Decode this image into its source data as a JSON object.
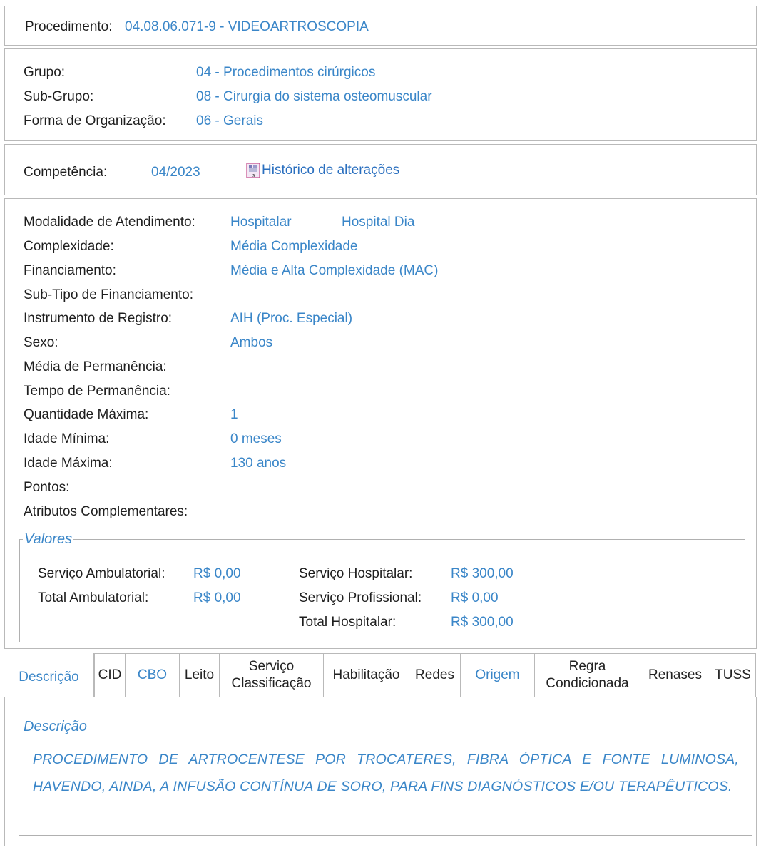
{
  "procedimento": {
    "label": "Procedimento:",
    "value": "04.08.06.071-9 - VIDEOARTROSCOPIA"
  },
  "classificacao": {
    "grupo_label": "Grupo:",
    "grupo_value": "04 - Procedimentos cirúrgicos",
    "subgrupo_label": "Sub-Grupo:",
    "subgrupo_value": "08 - Cirurgia do sistema osteomuscular",
    "forma_label": "Forma de Organização:",
    "forma_value": "06 - Gerais"
  },
  "competencia": {
    "label": "Competência:",
    "value": "04/2023",
    "historico_link": "Histórico de alterações",
    "historico_icon": "excel-icon"
  },
  "atributos": {
    "modalidade_label": "Modalidade de Atendimento:",
    "modalidade_value_1": "Hospitalar",
    "modalidade_value_2": "Hospital Dia",
    "complexidade_label": "Complexidade:",
    "complexidade_value": "Média Complexidade",
    "financiamento_label": "Financiamento:",
    "financiamento_value": "Média e Alta Complexidade (MAC)",
    "subtipo_label": "Sub-Tipo de Financiamento:",
    "instrumento_label": "Instrumento de Registro:",
    "instrumento_value": "AIH (Proc. Especial)",
    "sexo_label": "Sexo:",
    "sexo_value": "Ambos",
    "media_perm_label": "Média de Permanência:",
    "tempo_perm_label": "Tempo de Permanência:",
    "qtd_max_label": "Quantidade Máxima:",
    "qtd_max_value": "1",
    "idade_min_label": "Idade Mínima:",
    "idade_min_value": "0 meses",
    "idade_max_label": "Idade Máxima:",
    "idade_max_value": "130 anos",
    "pontos_label": "Pontos:",
    "atrib_compl_label": "Atributos Complementares:"
  },
  "valores": {
    "legend": "Valores",
    "serv_amb_label": "Serviço Ambulatorial:",
    "serv_amb_value": "R$ 0,00",
    "total_amb_label": "Total Ambulatorial:",
    "total_amb_value": "R$ 0,00",
    "serv_hosp_label": "Serviço Hospitalar:",
    "serv_hosp_value": "R$ 300,00",
    "serv_prof_label": "Serviço Profissional:",
    "serv_prof_value": "R$ 0,00",
    "total_hosp_label": "Total Hospitalar:",
    "total_hosp_value": "R$ 300,00"
  },
  "tabs": {
    "descricao": "Descrição",
    "cid": "CID",
    "cbo": "CBO",
    "leito": "Leito",
    "servico_l1": "Serviço",
    "servico_l2": "Classificação",
    "habilitacao": "Habilitação",
    "redes": "Redes",
    "origem": "Origem",
    "regra_l1": "Regra",
    "regra_l2": "Condicionada",
    "renases": "Renases",
    "tuss": "TUSS"
  },
  "descricao": {
    "legend": "Descrição",
    "text": "PROCEDIMENTO DE ARTROCENTESE POR TROCATERES, FIBRA ÓPTICA E FONTE LUMINOSA, HAVENDO, AINDA, A INFUSÃO CONTÍNUA DE SORO, PARA FINS DIAGNÓSTICOS E/OU TERAPÊUTICOS."
  },
  "colors": {
    "value_blue": "#3a86c8",
    "link_blue": "#2a6fbf",
    "border_gray": "#b9b9b9"
  }
}
